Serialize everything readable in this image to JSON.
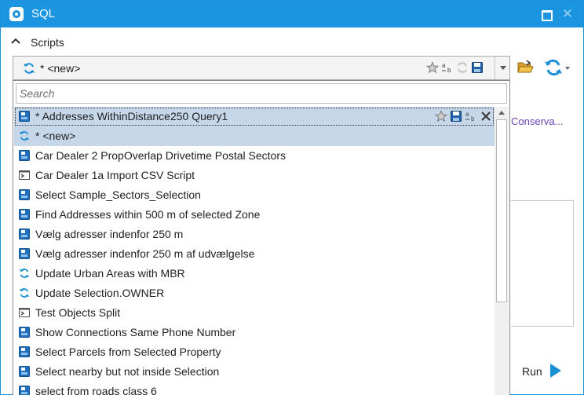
{
  "window": {
    "title": "SQL"
  },
  "scripts": {
    "header_label": "Scripts",
    "combo": {
      "value": "* <new>"
    }
  },
  "background": {
    "link_text": "Conserva...",
    "run_label": "Run"
  },
  "dropdown": {
    "search_placeholder": "Search",
    "items": [
      {
        "label": "* Addresses WithinDistance250 Query1",
        "icon": "sql-script-icon",
        "state": "selected"
      },
      {
        "label": "* <new>",
        "icon": "refresh-icon",
        "state": "current"
      },
      {
        "label": "Car Dealer 2 PropOverlap Drivetime Postal Sectors",
        "icon": "sql-script-icon"
      },
      {
        "label": "Car Dealer 1a Import CSV Script",
        "icon": "console-script-icon"
      },
      {
        "label": "Select Sample_Sectors_Selection",
        "icon": "sql-script-icon"
      },
      {
        "label": "Find Addresses within 500 m of selected Zone",
        "icon": "sql-script-icon"
      },
      {
        "label": "Vælg adresser indenfor 250 m",
        "icon": "sql-script-icon"
      },
      {
        "label": "Vælg adresser indenfor 250 m af udvælgelse",
        "icon": "sql-script-icon"
      },
      {
        "label": "Update Urban Areas with MBR",
        "icon": "refresh-icon"
      },
      {
        "label": "Update Selection.OWNER",
        "icon": "refresh-icon"
      },
      {
        "label": "Test Objects Split",
        "icon": "console-script-icon"
      },
      {
        "label": "Show Connections Same Phone Number",
        "icon": "sql-script-icon"
      },
      {
        "label": "Select Parcels from Selected Property",
        "icon": "sql-script-icon"
      },
      {
        "label": "Select nearby but not  inside Selection",
        "icon": "sql-script-icon"
      },
      {
        "label": "select from roads class 6",
        "icon": "sql-script-icon"
      }
    ]
  },
  "colors": {
    "accent": "#1b95e0",
    "selection": "#c7d7ea",
    "link": "#6a3fb5"
  }
}
